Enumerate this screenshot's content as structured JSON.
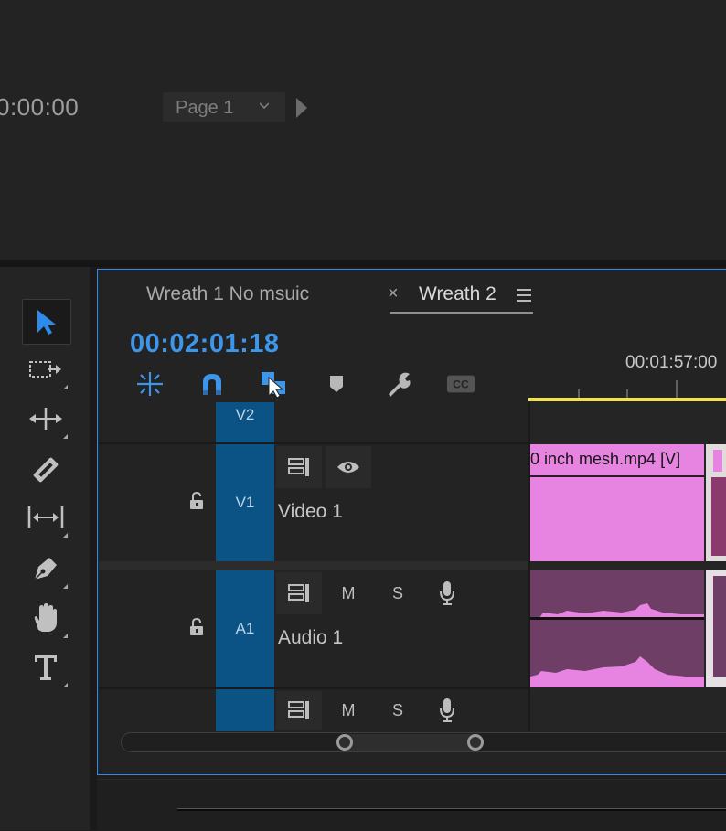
{
  "program_monitor": {
    "timecode": "0:00:00",
    "page_select": "Page 1"
  },
  "timeline": {
    "tabs": [
      {
        "label": "Wreath 1 No msuic",
        "active": false
      },
      {
        "label": "Wreath 2",
        "active": true
      }
    ],
    "tab_close": "×",
    "sequence_timecode": "00:02:01:18",
    "ruler_time": "00:01:57:00",
    "tools": [
      "snap-icon",
      "magnet-icon",
      "linked-selection-icon",
      "marker-icon",
      "wrench-icon",
      "captions-icon"
    ]
  },
  "tracks": {
    "v2": {
      "target": "V2"
    },
    "v1": {
      "target": "V1",
      "name": "Video 1"
    },
    "a1": {
      "target": "A1",
      "name": "Audio 1",
      "mute": "M",
      "solo": "S"
    },
    "a2": {
      "mute": "M",
      "solo": "S"
    }
  },
  "clips": {
    "v1_clip_name": "0 inch mesh.mp4 [V]"
  },
  "colors": {
    "accent": "#3c96ea",
    "target_track": "#0b5285",
    "video_clip": "#e784e1",
    "audio_clip": "#6e3e67",
    "playhead_bar": "#f2e44a"
  }
}
